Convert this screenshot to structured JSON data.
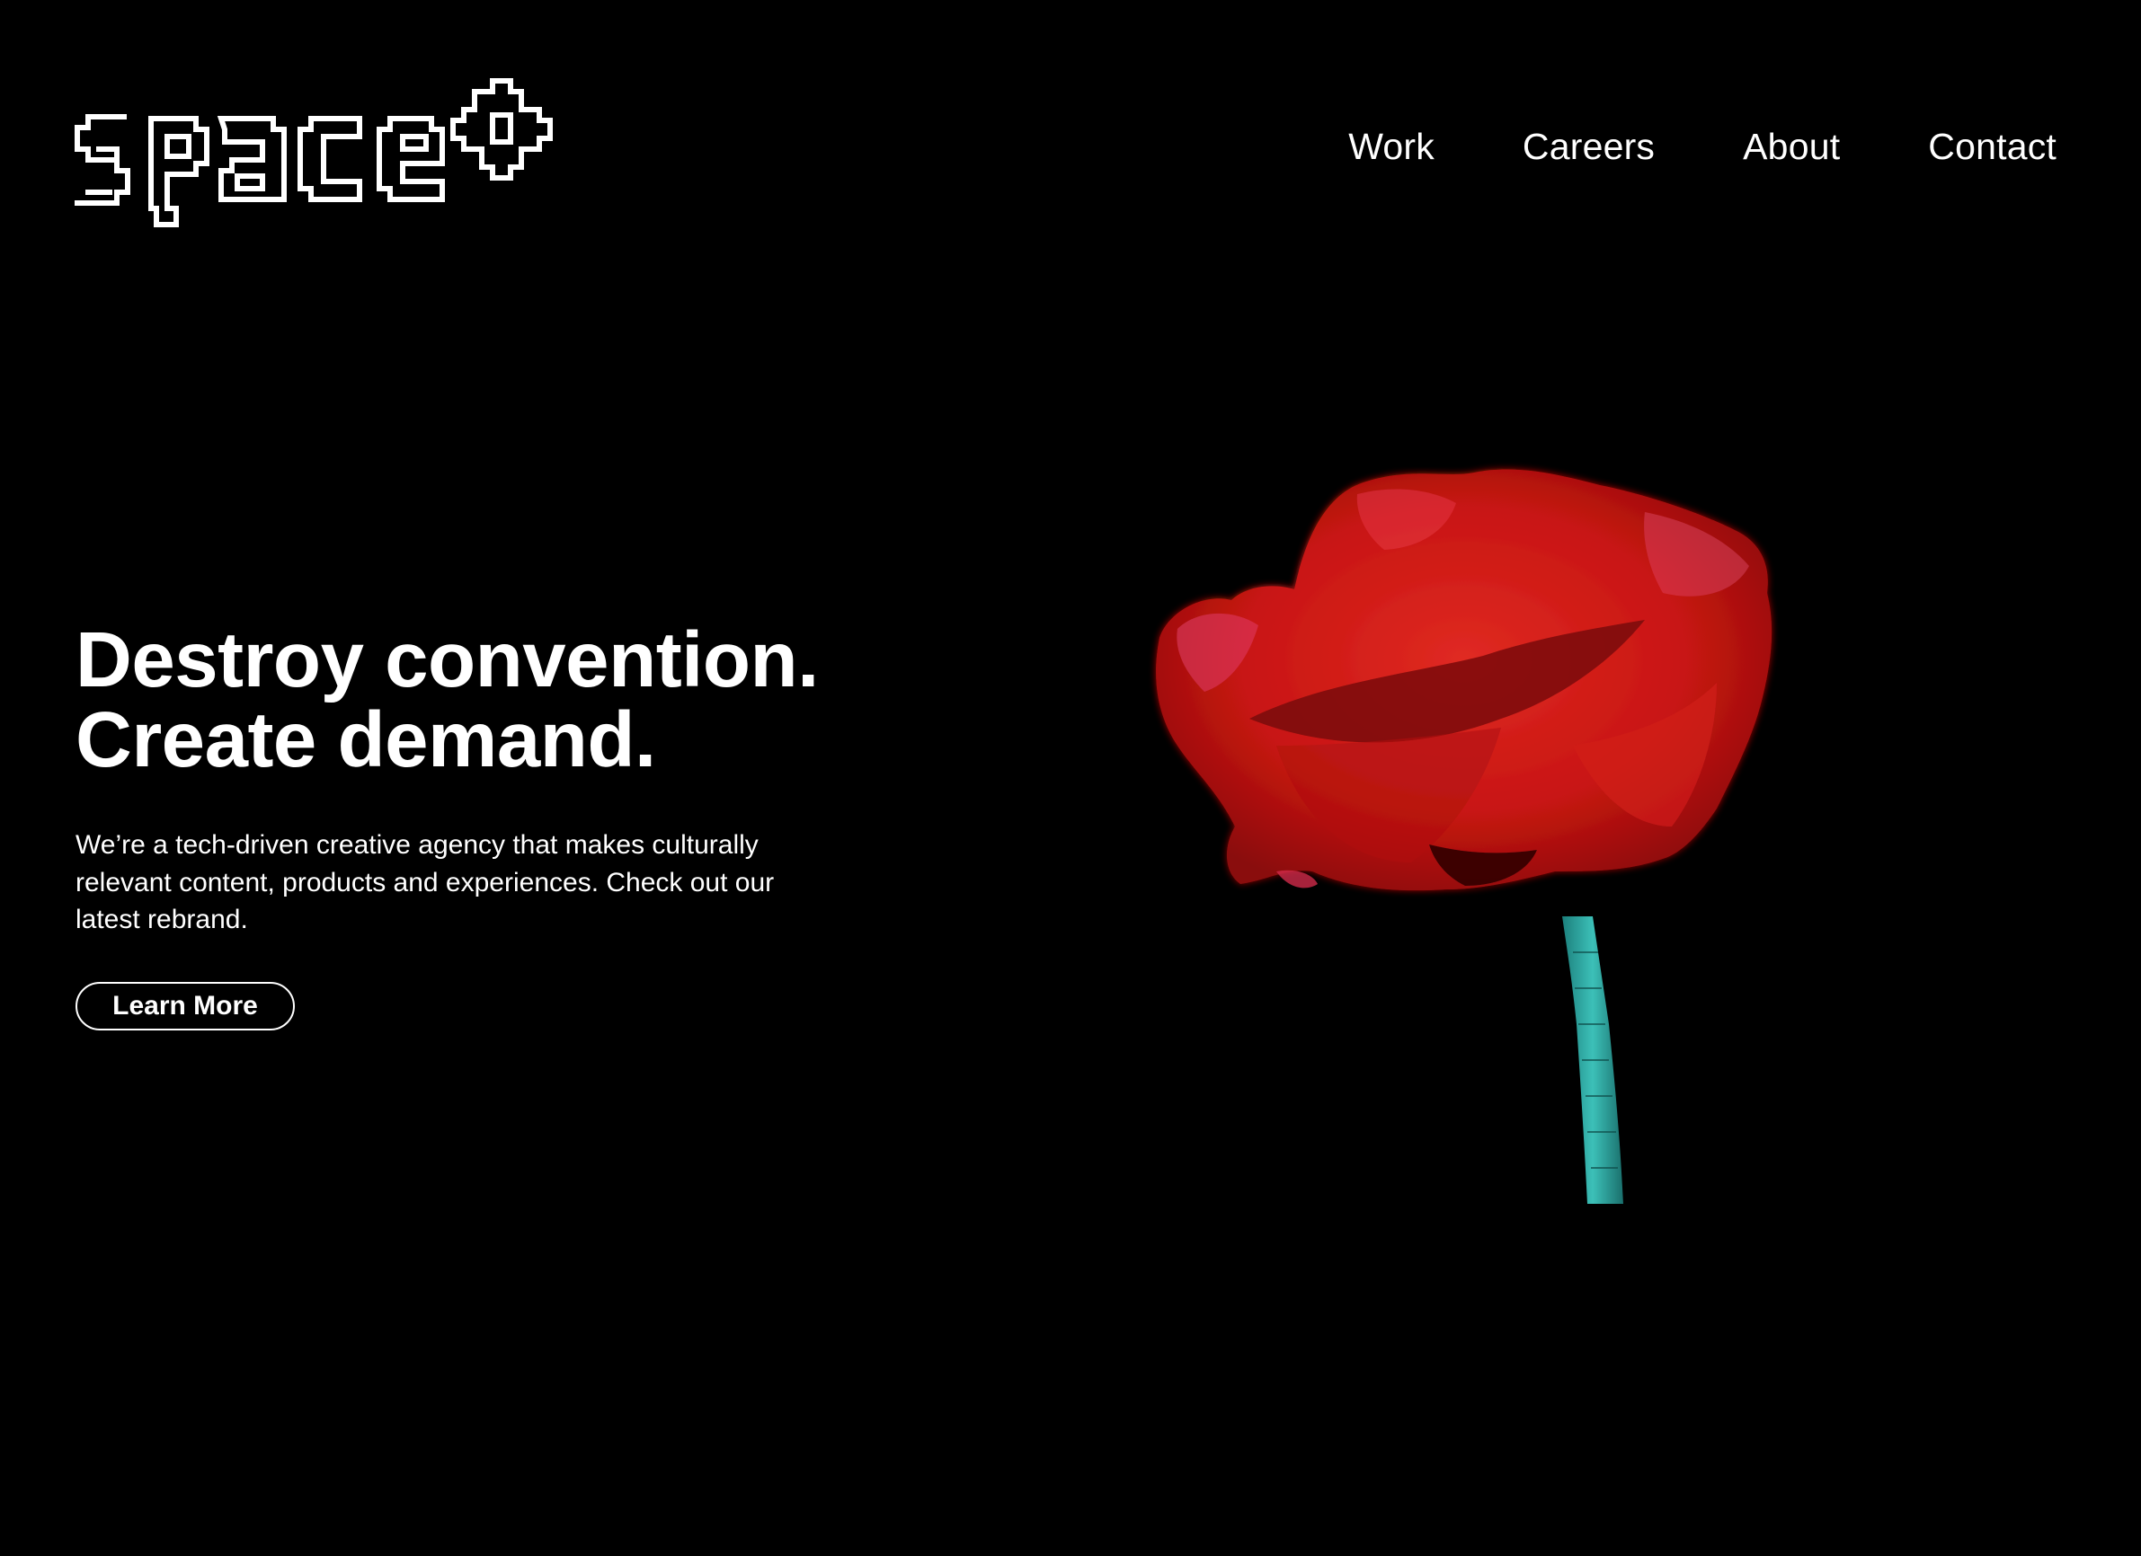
{
  "header": {
    "logo": {
      "alt": "Space",
      "icon": "flower-pixel-logo"
    },
    "nav": [
      {
        "label": "Work"
      },
      {
        "label": "Careers"
      },
      {
        "label": "About"
      },
      {
        "label": "Contact"
      }
    ]
  },
  "hero": {
    "headline_line1": "Destroy convention.",
    "headline_line2": "Create demand.",
    "description": "We’re a tech-driven creative agency that makes culturally relevant content, products and experiences. Check out our latest rebrand.",
    "cta_label": "Learn More",
    "media": {
      "icon": "red-poppy-image"
    }
  },
  "colors": {
    "background": "#000000",
    "text": "#ffffff",
    "flower_red": "#d31a18",
    "stem_teal": "#2fa6a0"
  }
}
